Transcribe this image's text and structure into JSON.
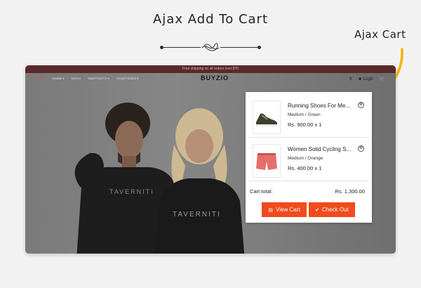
{
  "page": {
    "heading": "Ajax Add To Cart",
    "annotation_label": "Ajax Cart"
  },
  "store": {
    "announcement": "Free shipping on all orders over $75",
    "logo": "BUYZIO",
    "nav": [
      {
        "label": "HOME",
        "active": true
      },
      {
        "label": "SHAME ▾",
        "active": false
      },
      {
        "label": "SOFA ▾",
        "active": false
      },
      {
        "label": "SMARTWATCH ▾",
        "active": false
      },
      {
        "label": "HEADPHONES ▾",
        "active": false
      }
    ],
    "header_icons": [
      "search-icon",
      "user-icon",
      "cart-icon"
    ],
    "login_label": "Login",
    "shirt_brand": "TAVERNITI"
  },
  "cart": {
    "items": [
      {
        "name": "Running Shoes For Me...",
        "variant": "Medium / Green",
        "price": "Rs. 900.00 x 1",
        "thumb": "green-sneaker"
      },
      {
        "name": "Women Solid Cycling S...",
        "variant": "Medium / Orange",
        "price": "Rs. 400.00 x 1",
        "thumb": "coral-shorts"
      }
    ],
    "total_label": "Cart total:",
    "total_value": "Rs. 1,300.00",
    "view_cart_label": "View Cart",
    "checkout_label": "Check Out",
    "remove_icon": "⊗"
  },
  "colors": {
    "accent": "#f24a1d",
    "annotation_arrow": "#f5b400",
    "topbar": "#5a2a2a"
  }
}
